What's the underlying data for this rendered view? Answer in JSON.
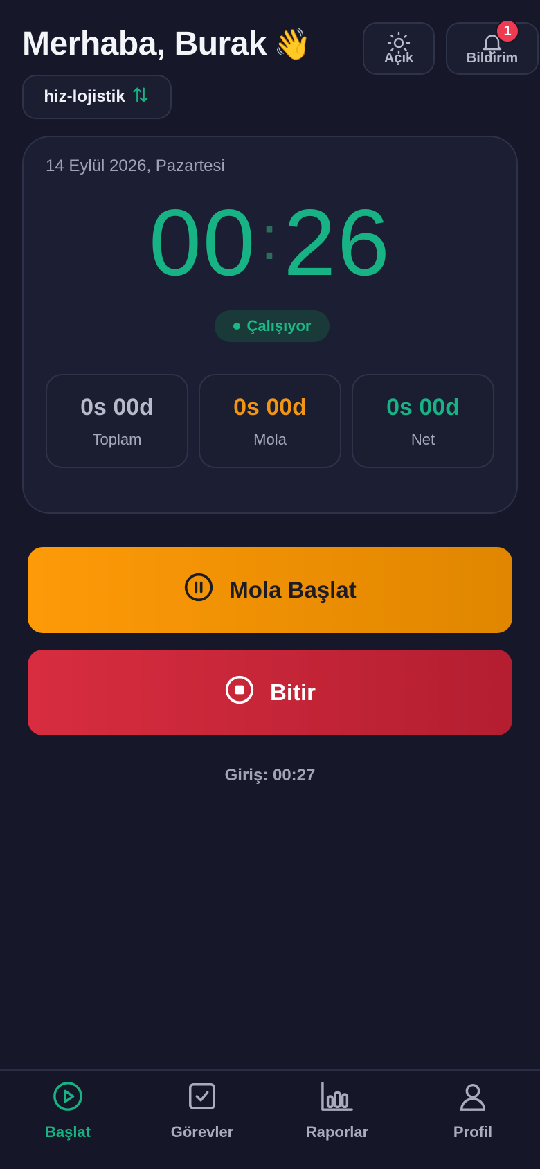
{
  "header": {
    "greeting": "Merhaba, Burak",
    "wave_emoji": "👋",
    "theme_label": "Açık",
    "notifications_label": "Bildirim",
    "notification_count": "1",
    "workspace": "hiz-lojistik"
  },
  "timer_card": {
    "date": "14 Eylül 2026, Pazartesi",
    "hours": "00",
    "separator": ":",
    "minutes": "26",
    "status": "Çalışıyor",
    "stats": [
      {
        "value": "0s 00d",
        "label": "Toplam"
      },
      {
        "value": "0s 00d",
        "label": "Mola"
      },
      {
        "value": "0s 00d",
        "label": "Net"
      }
    ]
  },
  "actions": {
    "break_label": "Mola Başlat",
    "finish_label": "Bitir"
  },
  "checkin": "Giriş: 00:27",
  "nav": [
    {
      "label": "Başlat",
      "icon": "play-circle-icon",
      "active": true
    },
    {
      "label": "Görevler",
      "icon": "checkbox-icon"
    },
    {
      "label": "Raporlar",
      "icon": "bar-chart-icon"
    },
    {
      "label": "Profil",
      "icon": "user-icon"
    }
  ],
  "colors": {
    "accent": "#17b384",
    "break": "#f39514",
    "danger": "#d82d40",
    "background": "#161829"
  }
}
